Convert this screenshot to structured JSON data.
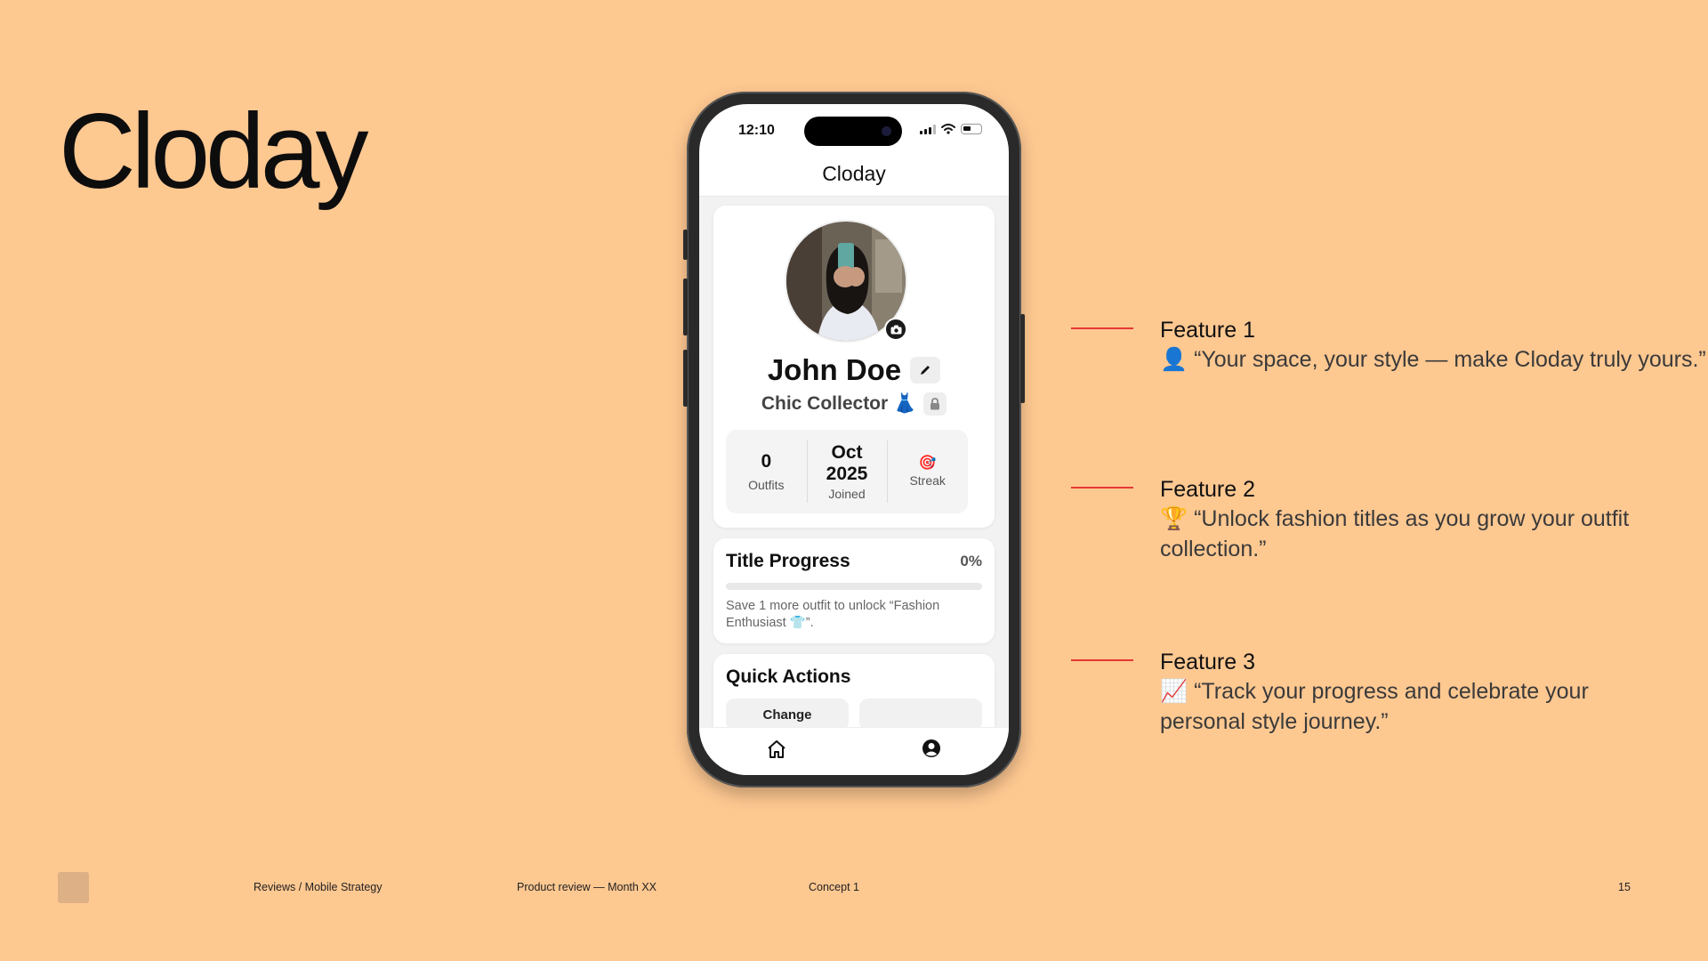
{
  "slide": {
    "title": "Cloday",
    "footer": {
      "breadcrumb": "Reviews / Mobile Strategy",
      "review": "Product review — Month XX",
      "concept": "Concept 1",
      "page_number": "15"
    }
  },
  "phone": {
    "status_bar": {
      "time": "12:10"
    },
    "app_header": "Cloday",
    "profile": {
      "name": "John Doe",
      "title": "Chic Collector 👗",
      "stats": [
        {
          "value": "0",
          "label": "Outfits"
        },
        {
          "value": "Oct\n2025",
          "label": "Joined"
        },
        {
          "value": "🎯",
          "label": "Streak"
        }
      ]
    },
    "title_progress": {
      "heading": "Title Progress",
      "percent_label": "0%",
      "progress_fraction": 0,
      "hint": "Save 1 more outfit to unlock “Fashion Enthusiast 👕”."
    },
    "quick_actions": {
      "heading": "Quick Actions",
      "buttons": [
        "Change",
        ""
      ]
    },
    "tabbar": [
      "home-icon",
      "profile-icon"
    ]
  },
  "features": [
    {
      "name": "Feature 1",
      "description": "👤 “Your space, your style — make Cloday truly yours.”"
    },
    {
      "name": "Feature 2",
      "description": "🏆 “Unlock fashion titles as you grow your outfit collection.”"
    },
    {
      "name": "Feature 3",
      "description": "📈 “Track your progress and celebrate your personal style journey.”"
    }
  ],
  "colors": {
    "background": "#FEC891",
    "accent_line": "#E53935",
    "footer_square": "#DDB185"
  }
}
